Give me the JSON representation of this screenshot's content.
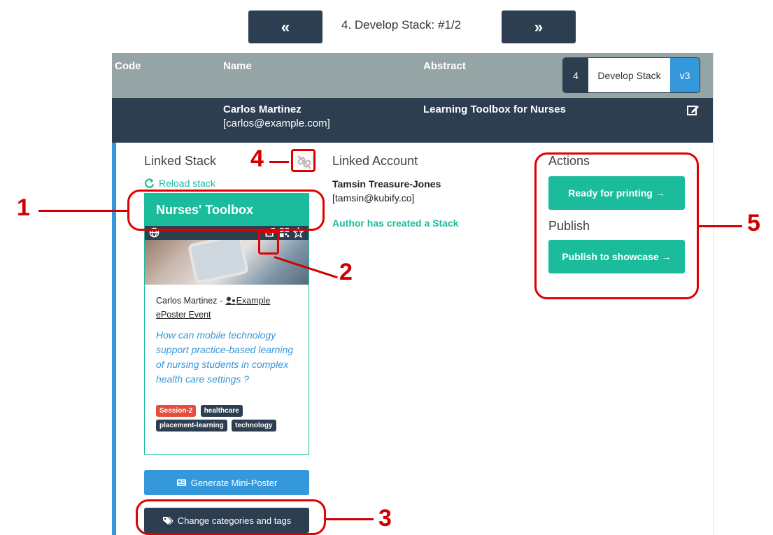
{
  "nav": {
    "prev_label": "«",
    "title": "4. Develop Stack:  #1/2",
    "next_label": "»"
  },
  "header": {
    "col_code": "Code",
    "col_name": "Name",
    "col_abstract": "Abstract",
    "step_number": "4",
    "step_label": "Develop Stack",
    "step_version": "v3"
  },
  "row": {
    "name": "Carlos Martinez",
    "email": "[carlos@example.com]",
    "abstract": "Learning Toolbox for Nurses",
    "edit_icon": "edit-icon"
  },
  "linked_stack": {
    "heading": "Linked Stack",
    "reload_label": "Reload stack",
    "card": {
      "title": "Nurses' Toolbox",
      "author": "Carlos Martinez - ",
      "event_line1": "Example",
      "event_line2": "ePoster Event",
      "question": "How can mobile technology support practice-based learning of nursing students in complex health care settings ?",
      "tags": [
        "Session-2",
        "healthcare",
        "placement-learning",
        "technology"
      ]
    },
    "generate_label": "Generate Mini-Poster",
    "categories_label": "Change categories and tags"
  },
  "linked_account": {
    "heading": "Linked Account",
    "name": "Tamsin Treasure-Jones",
    "email": "[tamsin@kubify.co]",
    "status": "Author has created a Stack"
  },
  "actions": {
    "heading": "Actions",
    "ready_label": "Ready for printing →",
    "publish_heading": "Publish",
    "publish_label": "Publish to showcase →"
  },
  "callouts": {
    "one": "1",
    "two": "2",
    "three": "3",
    "four": "4",
    "five": "5"
  },
  "colors": {
    "dark": "#2c3e50",
    "teal": "#1abc9c",
    "blue": "#3498db",
    "grey": "#95a5a6",
    "callout_red": "#e00000"
  }
}
